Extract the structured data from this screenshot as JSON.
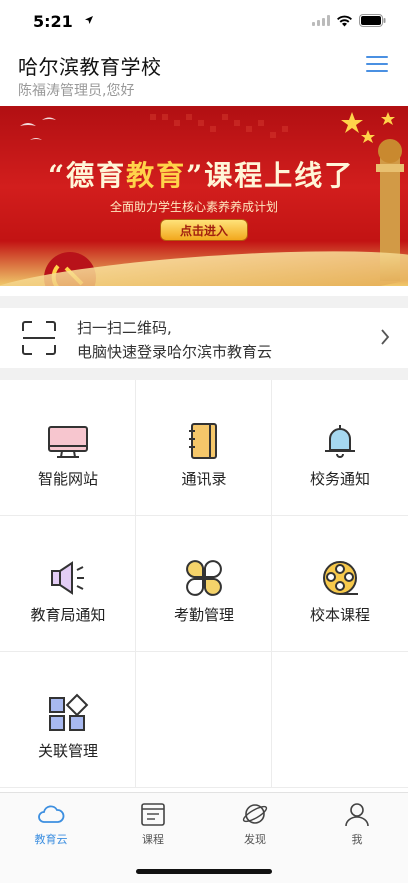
{
  "status_bar": {
    "time": "5:21"
  },
  "header": {
    "school_name": "哈尔滨教育学校",
    "greeting": "陈福涛管理员,您好"
  },
  "banner": {
    "title_quote_left": "“德育",
    "title_highlight": "教育",
    "title_quote_right": "”课程上线了",
    "subtitle": "全面助力学生核心素养养成计划",
    "button_label": "点击进入"
  },
  "qr_login": {
    "line1": "扫一扫二维码,",
    "line2": "电脑快速登录哈尔滨市教育云"
  },
  "grid": {
    "items": [
      {
        "label": "智能网站",
        "icon": "monitor-icon"
      },
      {
        "label": "通讯录",
        "icon": "notebook-icon"
      },
      {
        "label": "校务通知",
        "icon": "bell-icon"
      },
      {
        "label": "教育局通知",
        "icon": "speaker-icon"
      },
      {
        "label": "考勤管理",
        "icon": "clover-icon"
      },
      {
        "label": "校本课程",
        "icon": "film-reel-icon"
      },
      {
        "label": "关联管理",
        "icon": "blocks-icon"
      }
    ]
  },
  "tabbar": {
    "tabs": [
      {
        "label": "教育云",
        "icon": "cloud-icon",
        "active": true
      },
      {
        "label": "课程",
        "icon": "calendar-icon",
        "active": false
      },
      {
        "label": "发现",
        "icon": "planet-icon",
        "active": false
      },
      {
        "label": "我",
        "icon": "person-icon",
        "active": false
      }
    ]
  },
  "colors": {
    "accent": "#3d8fe0",
    "banner_red": "#c8171a",
    "gold": "#ffd34a"
  }
}
